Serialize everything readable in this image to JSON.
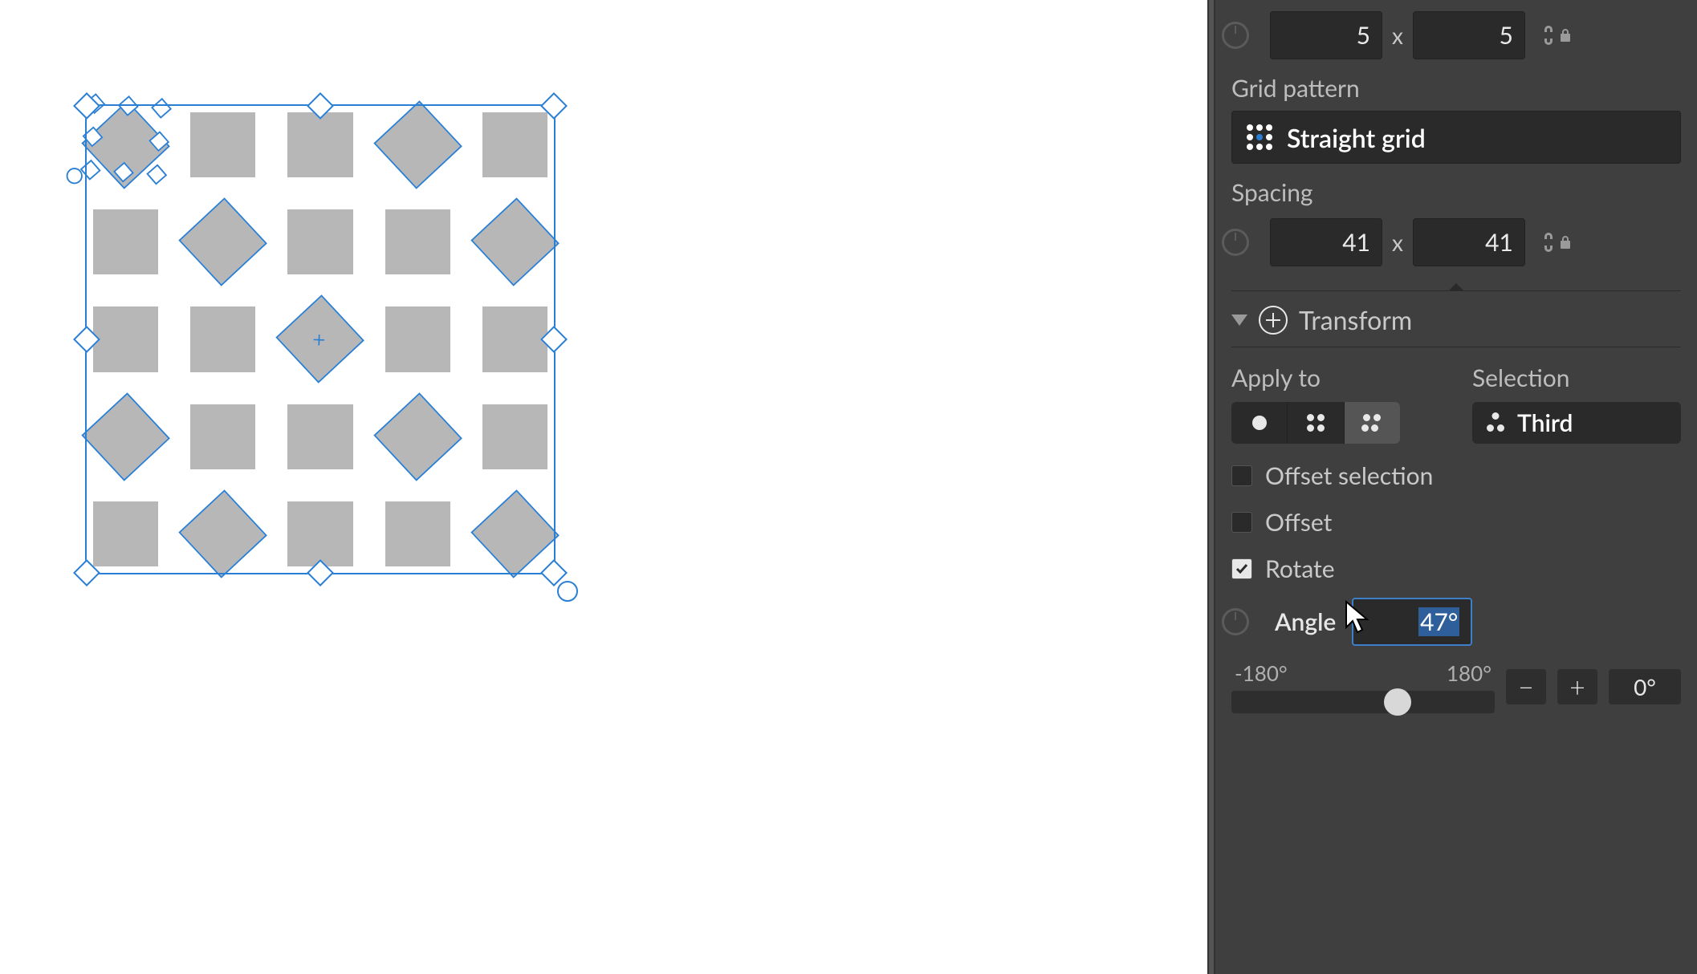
{
  "canvas": {
    "grid": {
      "cols": 5,
      "rows": 5,
      "selected_rotation": 47
    }
  },
  "panel": {
    "dimensions": {
      "cols": "5",
      "times": "x",
      "rows": "5"
    },
    "grid_pattern": {
      "label": "Grid pattern",
      "value": "Straight grid"
    },
    "spacing": {
      "label": "Spacing",
      "x": "41",
      "times": "x",
      "y": "41"
    },
    "transform": {
      "header": "Transform"
    },
    "apply_to": {
      "label": "Apply to"
    },
    "selection": {
      "label": "Selection",
      "value": "Third"
    },
    "offset_selection": {
      "label": "Offset selection",
      "checked": false
    },
    "offset": {
      "label": "Offset",
      "checked": false
    },
    "rotate": {
      "label": "Rotate",
      "checked": true
    },
    "angle": {
      "label": "Angle",
      "value": "47°"
    },
    "slider": {
      "min": "-180°",
      "max": "180°",
      "reset": "0°",
      "minus": "−",
      "plus": "+"
    }
  }
}
